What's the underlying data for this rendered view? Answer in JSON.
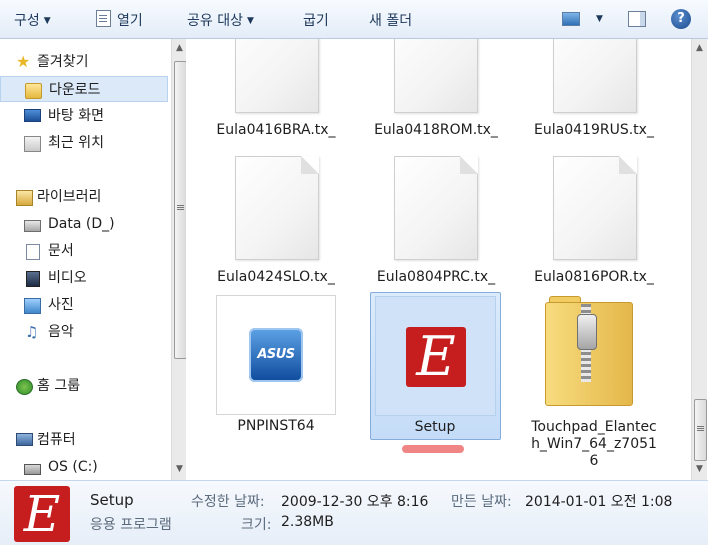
{
  "toolbar": {
    "organize": "구성",
    "open": "열기",
    "share": "공유 대상",
    "burn": "굽기",
    "new_folder": "새 폴더",
    "help": "?"
  },
  "nav": {
    "favorites": "즐겨찾기",
    "downloads": "다운로드",
    "desktop": "바탕 화면",
    "recent": "최근 위치",
    "libraries": "라이브러리",
    "data": "Data (D_)",
    "documents": "문서",
    "videos": "비디오",
    "pictures": "사진",
    "music": "음악",
    "homegroup": "홈 그룹",
    "computer": "컴퓨터",
    "os": "OS (C:)"
  },
  "files": [
    {
      "name": "Eula0416BRA.tx_",
      "type": "text"
    },
    {
      "name": "Eula0418ROM.tx_",
      "type": "text"
    },
    {
      "name": "Eula0419RUS.tx_",
      "type": "text"
    },
    {
      "name": "Eula0424SLO.tx_",
      "type": "text"
    },
    {
      "name": "Eula0804PRC.tx_",
      "type": "text"
    },
    {
      "name": "Eula0816POR.tx_",
      "type": "text"
    },
    {
      "name": "PNPINST64",
      "type": "exe-asus",
      "logo_text": "ASUS"
    },
    {
      "name": "Setup",
      "type": "exe-setup",
      "logo_text": "E",
      "selected": true
    },
    {
      "name": "Touchpad_Elantech_Win7_64_z70516",
      "type": "zip"
    }
  ],
  "details": {
    "name": "Setup",
    "type": "응용 프로그램",
    "modified_label": "수정한 날짜:",
    "modified": "2009-12-30 오후 8:16",
    "created_label": "만든 날짜:",
    "created": "2014-01-01 오전 1:08",
    "size_label": "크기:",
    "size": "2.38MB",
    "logo_text": "E"
  },
  "colors": {
    "selection": "#cfe2f8",
    "accent": "#1e395b",
    "setup_logo": "#c61e1e"
  }
}
